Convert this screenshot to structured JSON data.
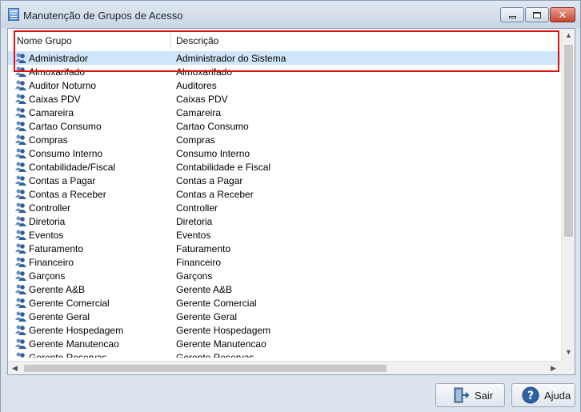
{
  "window": {
    "title": "Manutenção de Grupos de Acesso"
  },
  "columns": {
    "name": "Nome Grupo",
    "description": "Descrição"
  },
  "groups": [
    {
      "name": "Administrador",
      "description": "Administrador do Sistema",
      "selected": true
    },
    {
      "name": "Almoxarifado",
      "description": "Almoxarifado"
    },
    {
      "name": "Auditor Noturno",
      "description": "Auditores"
    },
    {
      "name": "Caixas PDV",
      "description": "Caixas PDV"
    },
    {
      "name": "Camareira",
      "description": "Camareira"
    },
    {
      "name": "Cartao Consumo",
      "description": "Cartao Consumo"
    },
    {
      "name": "Compras",
      "description": "Compras"
    },
    {
      "name": "Consumo Interno",
      "description": "Consumo Interno"
    },
    {
      "name": "Contabilidade/Fiscal",
      "description": "Contabilidade e Fiscal"
    },
    {
      "name": "Contas a Pagar",
      "description": "Contas a Pagar"
    },
    {
      "name": "Contas a Receber",
      "description": "Contas a Receber"
    },
    {
      "name": "Controller",
      "description": "Controller"
    },
    {
      "name": "Diretoria",
      "description": "Diretoria"
    },
    {
      "name": "Eventos",
      "description": "Eventos"
    },
    {
      "name": "Faturamento",
      "description": "Faturamento"
    },
    {
      "name": "Financeiro",
      "description": "Financeiro"
    },
    {
      "name": "Garçons",
      "description": "Garçons"
    },
    {
      "name": "Gerente A&B",
      "description": "Gerente A&B"
    },
    {
      "name": "Gerente Comercial",
      "description": "Gerente Comercial"
    },
    {
      "name": "Gerente Geral",
      "description": "Gerente Geral"
    },
    {
      "name": "Gerente Hospedagem",
      "description": "Gerente Hospedagem"
    },
    {
      "name": "Gerente Manutencao",
      "description": "Gerente Manutencao"
    },
    {
      "name": "Gerente Reservas",
      "description": "Gerente Reservas"
    }
  ],
  "buttons": {
    "exit": "Sair",
    "help": "Ajuda"
  },
  "icons": {
    "row": "user-group-icon",
    "exit": "exit-door-icon",
    "help": "help-icon"
  },
  "colors": {
    "selection": "#cfe5f8",
    "highlight": "#e01010"
  }
}
